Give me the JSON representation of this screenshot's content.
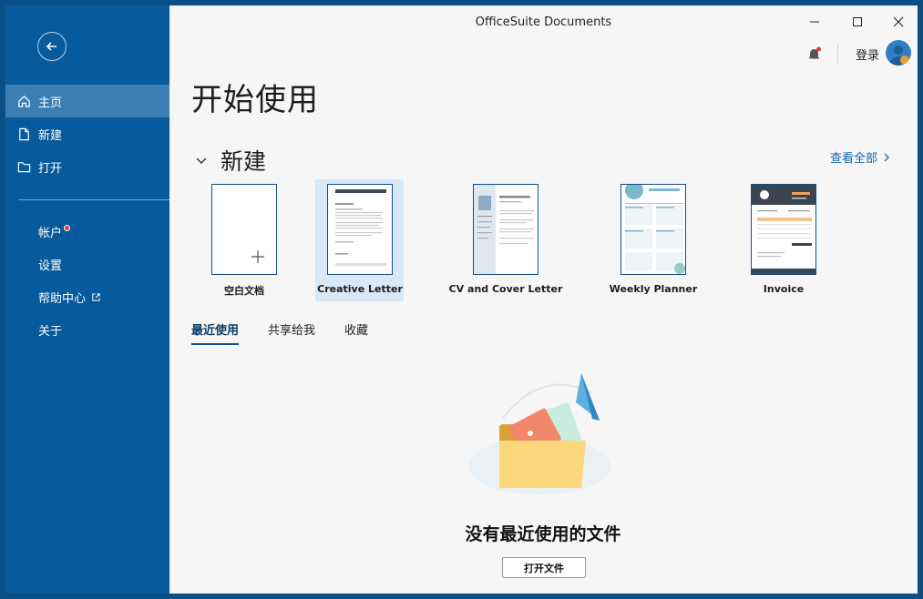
{
  "window": {
    "title": "OfficeSuite Documents"
  },
  "sidebar": {
    "items": [
      {
        "label": "主页",
        "icon": "home-icon"
      },
      {
        "label": "新建",
        "icon": "new-document-icon"
      },
      {
        "label": "打开",
        "icon": "folder-icon"
      }
    ],
    "secondary": [
      {
        "label": "帐户"
      },
      {
        "label": "设置"
      },
      {
        "label": "帮助中心"
      },
      {
        "label": "关于"
      }
    ]
  },
  "header": {
    "login_label": "登录"
  },
  "main": {
    "page_title": "开始使用",
    "new_section_title": "新建",
    "view_all_label": "查看全部",
    "templates": [
      {
        "label": "空白文档"
      },
      {
        "label": "Creative Letter"
      },
      {
        "label": "CV and Cover Letter"
      },
      {
        "label": "Weekly Planner"
      },
      {
        "label": "Invoice"
      }
    ],
    "tabs": [
      {
        "label": "最近使用"
      },
      {
        "label": "共享给我"
      },
      {
        "label": "收藏"
      }
    ],
    "empty_state_title": "没有最近使用的文件",
    "open_file_label": "打开文件"
  },
  "colors": {
    "sidebar": "#075a9c",
    "sidebar_active": "#3c7fb5",
    "accent": "#1666b0",
    "notification": "#e63b3b"
  }
}
